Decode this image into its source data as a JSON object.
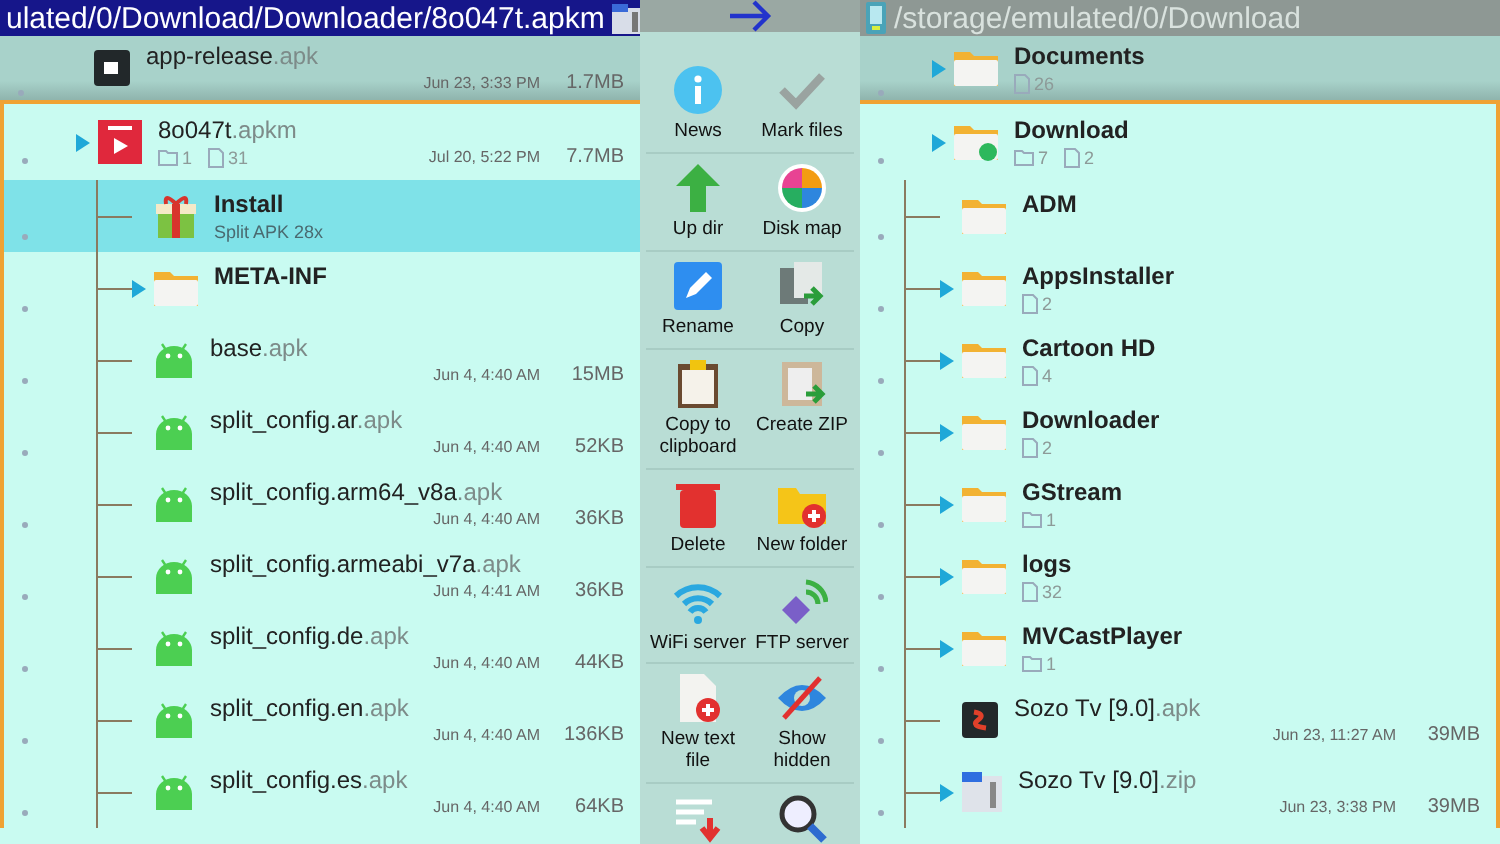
{
  "panes": [
    {
      "active": true,
      "path": "ulated/0/Download/Downloader/8o047t.apkm",
      "kind": "archive",
      "top": {
        "kind": "app",
        "name": "app-release",
        "ext": ".apk",
        "date": "Jun 23, 3:33 PM",
        "size": "1.7MB",
        "expandable": false
      },
      "parent": {
        "kind": "archive",
        "name": "8o047t",
        "ext": ".apkm",
        "folders": "1",
        "files": "31",
        "date": "Jul 20, 5:22 PM",
        "size": "7.7MB",
        "expandable": true
      },
      "children": [
        {
          "kind": "action",
          "name": "Install",
          "sub": "Split APK 28x",
          "selected": true,
          "expandable": false
        },
        {
          "kind": "folder",
          "name": "META-INF",
          "selected": false,
          "expandable": true
        },
        {
          "kind": "apk",
          "name": "base",
          "ext": ".apk",
          "date": "Jun 4, 4:40 AM",
          "size": "15MB",
          "selected": false,
          "expandable": false
        },
        {
          "kind": "apk",
          "name": "split_config.ar",
          "ext": ".apk",
          "date": "Jun 4, 4:40 AM",
          "size": "52KB",
          "selected": false,
          "expandable": false
        },
        {
          "kind": "apk",
          "name": "split_config.arm64_v8a",
          "ext": ".apk",
          "date": "Jun 4, 4:40 AM",
          "size": "36KB",
          "selected": false,
          "expandable": false
        },
        {
          "kind": "apk",
          "name": "split_config.armeabi_v7a",
          "ext": ".apk",
          "date": "Jun 4, 4:41 AM",
          "size": "36KB",
          "selected": false,
          "expandable": false
        },
        {
          "kind": "apk",
          "name": "split_config.de",
          "ext": ".apk",
          "date": "Jun 4, 4:40 AM",
          "size": "44KB",
          "selected": false,
          "expandable": false
        },
        {
          "kind": "apk",
          "name": "split_config.en",
          "ext": ".apk",
          "date": "Jun 4, 4:40 AM",
          "size": "136KB",
          "selected": false,
          "expandable": false
        },
        {
          "kind": "apk",
          "name": "split_config.es",
          "ext": ".apk",
          "date": "Jun 4, 4:40 AM",
          "size": "64KB",
          "selected": false,
          "expandable": false
        }
      ]
    },
    {
      "active": false,
      "path": "/storage/emulated/0/Download",
      "kind": "storage",
      "top": {
        "kind": "folder",
        "name": "Documents",
        "files": "26",
        "expandable": true
      },
      "parent": {
        "kind": "download",
        "name": "Download",
        "folders": "7",
        "files": "2",
        "expandable": true
      },
      "children": [
        {
          "kind": "folder",
          "name": "ADM",
          "selected": false,
          "expandable": false
        },
        {
          "kind": "folder",
          "name": "AppsInstaller",
          "files": "2",
          "selected": false,
          "expandable": true
        },
        {
          "kind": "folder",
          "name": "Cartoon HD",
          "files": "4",
          "selected": false,
          "expandable": true
        },
        {
          "kind": "folder",
          "name": "Downloader",
          "files": "2",
          "selected": false,
          "expandable": true
        },
        {
          "kind": "folder",
          "name": "GStream",
          "folders": "1",
          "selected": false,
          "expandable": true
        },
        {
          "kind": "folder",
          "name": "logs",
          "files": "32",
          "selected": false,
          "expandable": true
        },
        {
          "kind": "folder",
          "name": "MVCastPlayer",
          "folders": "1",
          "selected": false,
          "expandable": true
        },
        {
          "kind": "app",
          "name": "Sozo Tv [9.0]",
          "ext": ".apk",
          "date": "Jun 23, 11:27 AM",
          "size": "39MB",
          "selected": false,
          "expandable": false
        },
        {
          "kind": "zip",
          "name": "Sozo Tv [9.0]",
          "ext": ".zip",
          "date": "Jun 23, 3:38 PM",
          "size": "39MB",
          "selected": false,
          "expandable": true
        }
      ]
    }
  ],
  "tools": [
    {
      "kind": "news",
      "label": "News"
    },
    {
      "kind": "mark",
      "label": "Mark files"
    },
    {
      "kind": "updir",
      "label": "Up dir"
    },
    {
      "kind": "diskmap",
      "label": "Disk map"
    },
    {
      "kind": "rename",
      "label": "Rename"
    },
    {
      "kind": "copy",
      "label": "Copy"
    },
    {
      "kind": "clipboard",
      "label": "Copy to clipboard"
    },
    {
      "kind": "zip",
      "label": "Create ZIP"
    },
    {
      "kind": "delete",
      "label": "Delete"
    },
    {
      "kind": "newfolder",
      "label": "New folder"
    },
    {
      "kind": "wifi",
      "label": "WiFi server"
    },
    {
      "kind": "ftp",
      "label": "FTP server"
    },
    {
      "kind": "newtext",
      "label": "New text file"
    },
    {
      "kind": "hidden",
      "label": "Show hidden"
    },
    {
      "kind": "sort"
    },
    {
      "kind": "find"
    }
  ]
}
